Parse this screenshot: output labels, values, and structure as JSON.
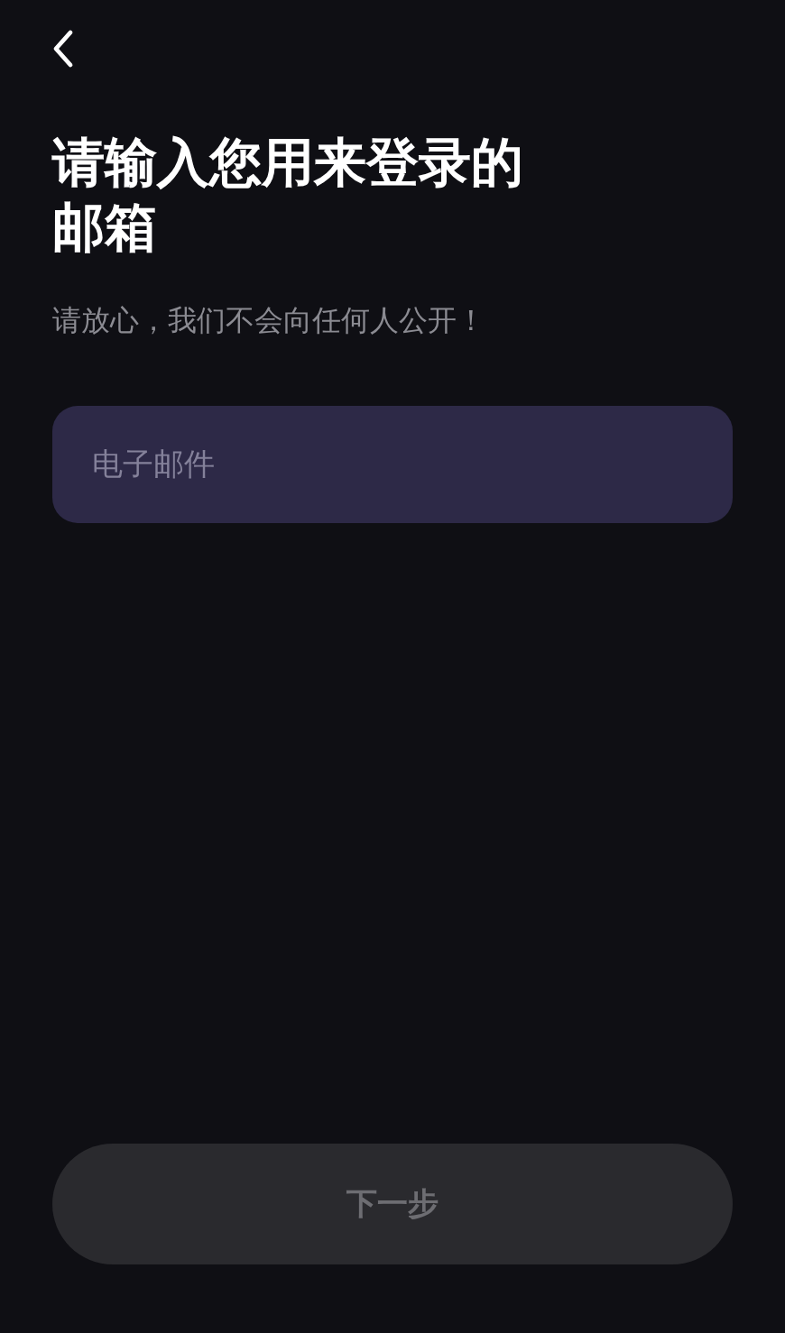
{
  "title": "请输入您用来登录的邮箱",
  "subtitle": "请放心，我们不会向任何人公开！",
  "email_field": {
    "placeholder": "电子邮件"
  },
  "next_button": {
    "label": "下一步",
    "disabled": true
  }
}
